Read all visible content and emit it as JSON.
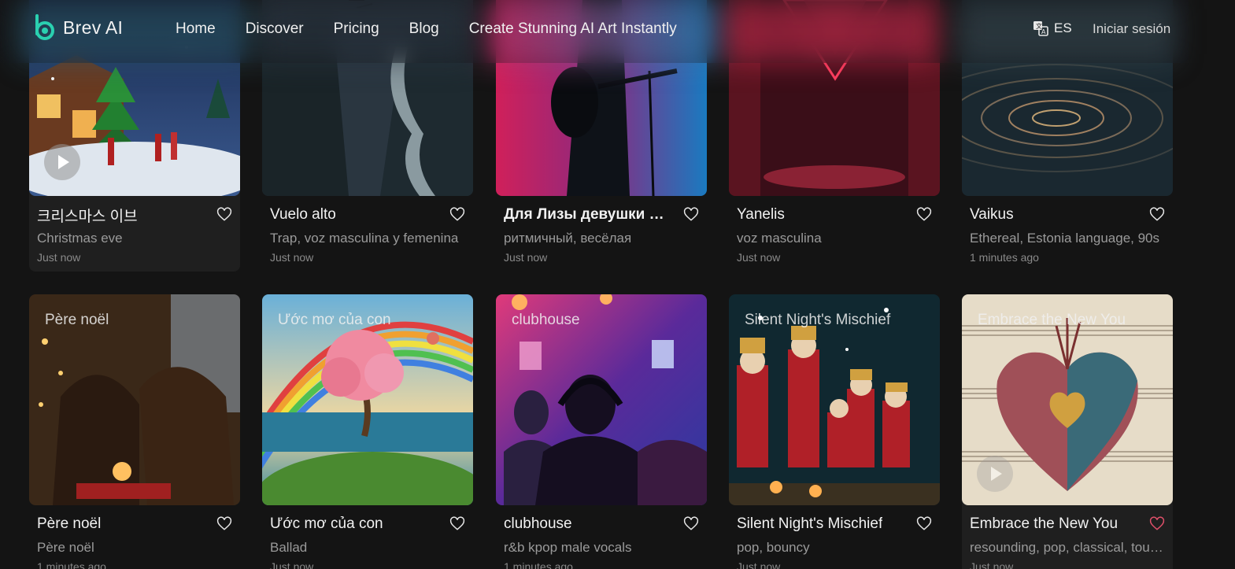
{
  "brand": {
    "name": "Brev AI",
    "accent": "#2ad0b0"
  },
  "nav": {
    "items": [
      "Home",
      "Discover",
      "Pricing",
      "Blog",
      "Create Stunning AI Art Instantly"
    ]
  },
  "language": {
    "label": "ES",
    "icon": "translate-icon"
  },
  "signin": {
    "label": "Iniciar sesión"
  },
  "row1": [
    {
      "title": "크리스마스 이브",
      "subtitle": "Christmas eve",
      "time": "Just now",
      "liked": false
    },
    {
      "title": "Vuelo alto",
      "subtitle": "Trap, voz masculina y femenina",
      "time": "Just now",
      "liked": false
    },
    {
      "title": "Для Лизы девушки моей",
      "subtitle": "ритмичный, весёлая",
      "time": "Just now",
      "liked": false
    },
    {
      "title": "Yanelis",
      "subtitle": "voz masculina",
      "time": "Just now",
      "liked": false
    },
    {
      "title": "Vaikus",
      "subtitle": "Ethereal, Estonia language, 90s",
      "time": "1 minutes ago",
      "liked": false
    }
  ],
  "row2": [
    {
      "overlay": "Père noël",
      "title": "Père noël",
      "subtitle": "Père noël",
      "time": "1 minutes ago",
      "liked": false
    },
    {
      "overlay": "Ước mơ của con",
      "title": "Ước mơ của con",
      "subtitle": "Ballad",
      "time": "Just now",
      "liked": false
    },
    {
      "overlay": "clubhouse",
      "title": "clubhouse",
      "subtitle": "r&b kpop male vocals",
      "time": "1 minutes ago",
      "liked": false
    },
    {
      "overlay": "Silent Night's Mischief",
      "title": "Silent Night's Mischief",
      "subtitle": "pop, bouncy",
      "time": "Just now",
      "liked": false
    },
    {
      "overlay": "Embrace the New You",
      "title": "Embrace the New You",
      "subtitle": "resounding, pop, classical, touching",
      "time": "Just now",
      "liked": true
    }
  ],
  "colors": {
    "heart_liked": "#e0506a",
    "heart_default": "#e8e8e8"
  }
}
